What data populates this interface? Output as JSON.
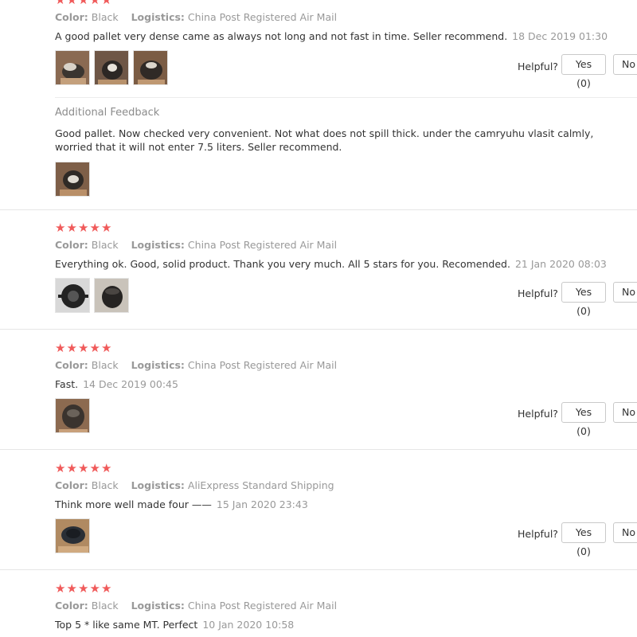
{
  "labels": {
    "color": "Color:",
    "logistics": "Logistics:",
    "helpful": "Helpful?",
    "additional_feedback": "Additional Feedback"
  },
  "colors": {
    "star": "#f05a5a",
    "meta_gray": "#999999",
    "text": "#333333"
  },
  "reviews": [
    {
      "stars": 5,
      "color": "Black",
      "logistics": "China Post Registered Air Mail",
      "text": "A good pallet very dense came as always not long and not fast in time. Seller recommend.",
      "date": "18 Dec 2019 01:30",
      "thumbnails": [
        "product-photo",
        "product-photo",
        "product-photo"
      ],
      "helpful_yes": "Yes (0)",
      "helpful_no": "No",
      "additional_feedback": {
        "line1": "Good pallet. Now checked very convenient. Not what does not spill thick. under the camryuhu vlasit calmly,",
        "line2": "worried that it will not enter 7.5 liters. Seller recommend.",
        "thumbnails": [
          "product-photo"
        ]
      }
    },
    {
      "stars": 5,
      "color": "Black",
      "logistics": "China Post Registered Air Mail",
      "text": "Everything ok. Good, solid product. Thank you very much. All 5 stars for you. Recomended.",
      "date": "21 Jan 2020 08:03",
      "thumbnails": [
        "product-photo",
        "product-photo"
      ],
      "helpful_yes": "Yes (0)",
      "helpful_no": "No"
    },
    {
      "stars": 5,
      "color": "Black",
      "logistics": "China Post Registered Air Mail",
      "text": "Fast.",
      "date": "14 Dec 2019 00:45",
      "thumbnails": [
        "product-photo"
      ],
      "helpful_yes": "Yes (0)",
      "helpful_no": "No"
    },
    {
      "stars": 5,
      "color": "Black",
      "logistics": "AliExpress Standard Shipping",
      "text": "Think more well made four ——",
      "date": "15 Jan 2020 23:43",
      "thumbnails": [
        "product-photo"
      ],
      "helpful_yes": "Yes (0)",
      "helpful_no": "No"
    },
    {
      "stars": 5,
      "color": "Black",
      "logistics": "China Post Registered Air Mail",
      "text": "Top 5 * like same MT. Perfect",
      "date": "10 Jan 2020 10:58"
    }
  ]
}
